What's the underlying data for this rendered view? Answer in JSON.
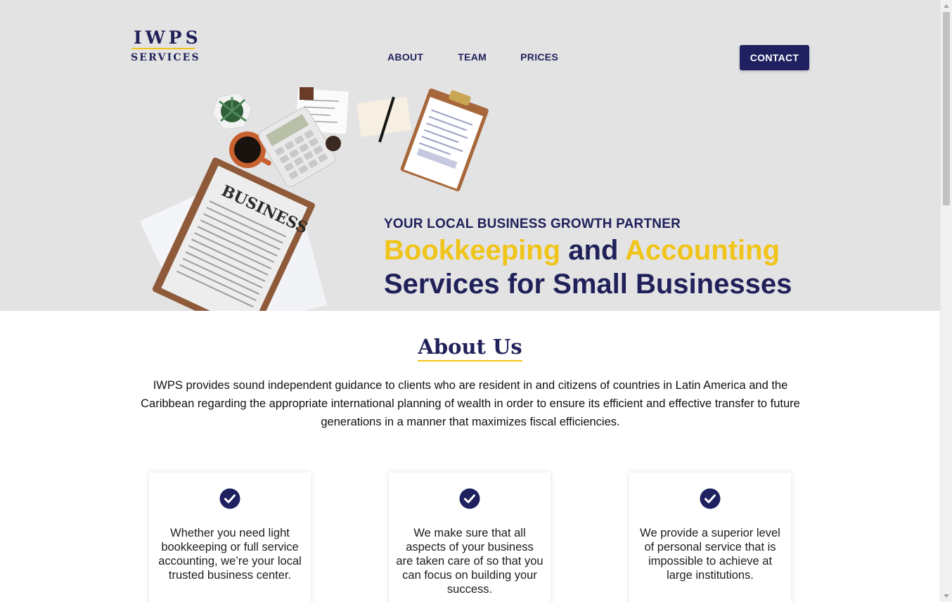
{
  "logo": {
    "main": "IWPS",
    "sub": "SERVICES"
  },
  "nav": {
    "about": "ABOUT",
    "team": "TEAM",
    "prices": "PRICES"
  },
  "contact_button": "CONTACT",
  "hero": {
    "tagline": "YOUR LOCAL BUSINESS GROWTH PARTNER",
    "headline_word1": "Bookkeeping",
    "headline_and": "and",
    "headline_word2": "Accounting",
    "headline_line2": "Services for Small Businesses",
    "newspaper_title": "BUSINESS"
  },
  "about": {
    "title": "About Us",
    "text": "IWPS provides sound independent guidance to clients who are resident in and citizens of countries in Latin America and the Caribbean regarding the appropriate international planning of wealth in order to ensure its efficient and effective transfer to future generations in a manner that maximizes fiscal efficiencies."
  },
  "cards": [
    {
      "icon": "check-circle-icon",
      "text": "Whether you need light bookkeeping or full service accounting, we’re your local trusted business center."
    },
    {
      "icon": "check-circle-icon",
      "text": "We make sure that all aspects of your business are taken care of so that you can focus on building your success."
    },
    {
      "icon": "check-circle-icon",
      "text": "We provide a superior level of personal service that is impossible to achieve at large institutions."
    }
  ],
  "colors": {
    "navy": "#1f2060",
    "gold": "#f0c419",
    "hero_bg": "#e3e3e4"
  }
}
